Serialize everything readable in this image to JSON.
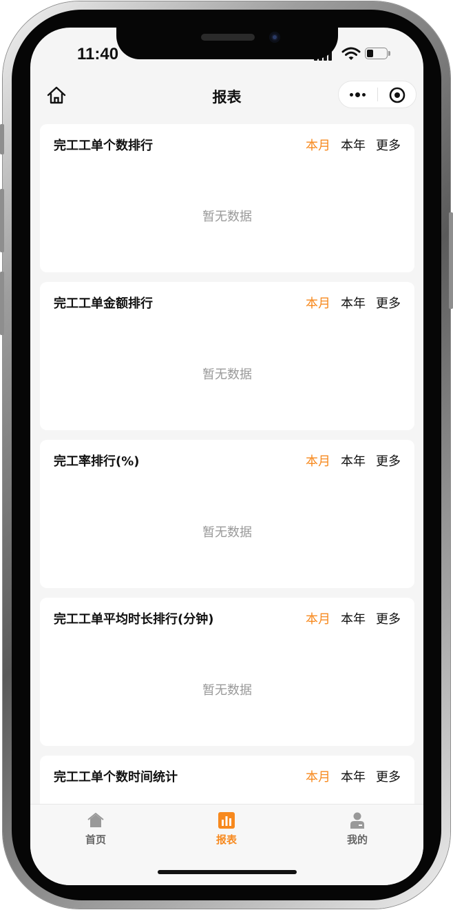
{
  "status": {
    "time": "11:40"
  },
  "nav": {
    "title": "报表"
  },
  "colors": {
    "accent": "#f7891e",
    "text": "#111111",
    "muted": "#999999",
    "background": "#f5f5f5"
  },
  "icons": [
    "home-outline-icon",
    "more-dots-icon",
    "target-close-icon",
    "home-icon",
    "bar-chart-icon",
    "user-icon"
  ],
  "cards": [
    {
      "title": "完工工单个数排行",
      "tabs": [
        "本月",
        "本年",
        "更多"
      ],
      "active_tab": "本月",
      "empty": "暂无数据"
    },
    {
      "title": "完工工单金额排行",
      "tabs": [
        "本月",
        "本年",
        "更多"
      ],
      "active_tab": "本月",
      "empty": "暂无数据"
    },
    {
      "title": "完工率排行(%)",
      "tabs": [
        "本月",
        "本年",
        "更多"
      ],
      "active_tab": "本月",
      "empty": "暂无数据"
    },
    {
      "title": "完工工单平均时长排行(分钟)",
      "tabs": [
        "本月",
        "本年",
        "更多"
      ],
      "active_tab": "本月",
      "empty": "暂无数据"
    },
    {
      "title": "完工工单个数时间统计",
      "tabs": [
        "本月",
        "本年",
        "更多"
      ],
      "active_tab": "本月"
    }
  ],
  "tabbar": {
    "items": [
      {
        "label": "首页",
        "icon": "home-icon",
        "active": false
      },
      {
        "label": "报表",
        "icon": "bar-chart-icon",
        "active": true
      },
      {
        "label": "我的",
        "icon": "user-icon",
        "active": false
      }
    ]
  }
}
